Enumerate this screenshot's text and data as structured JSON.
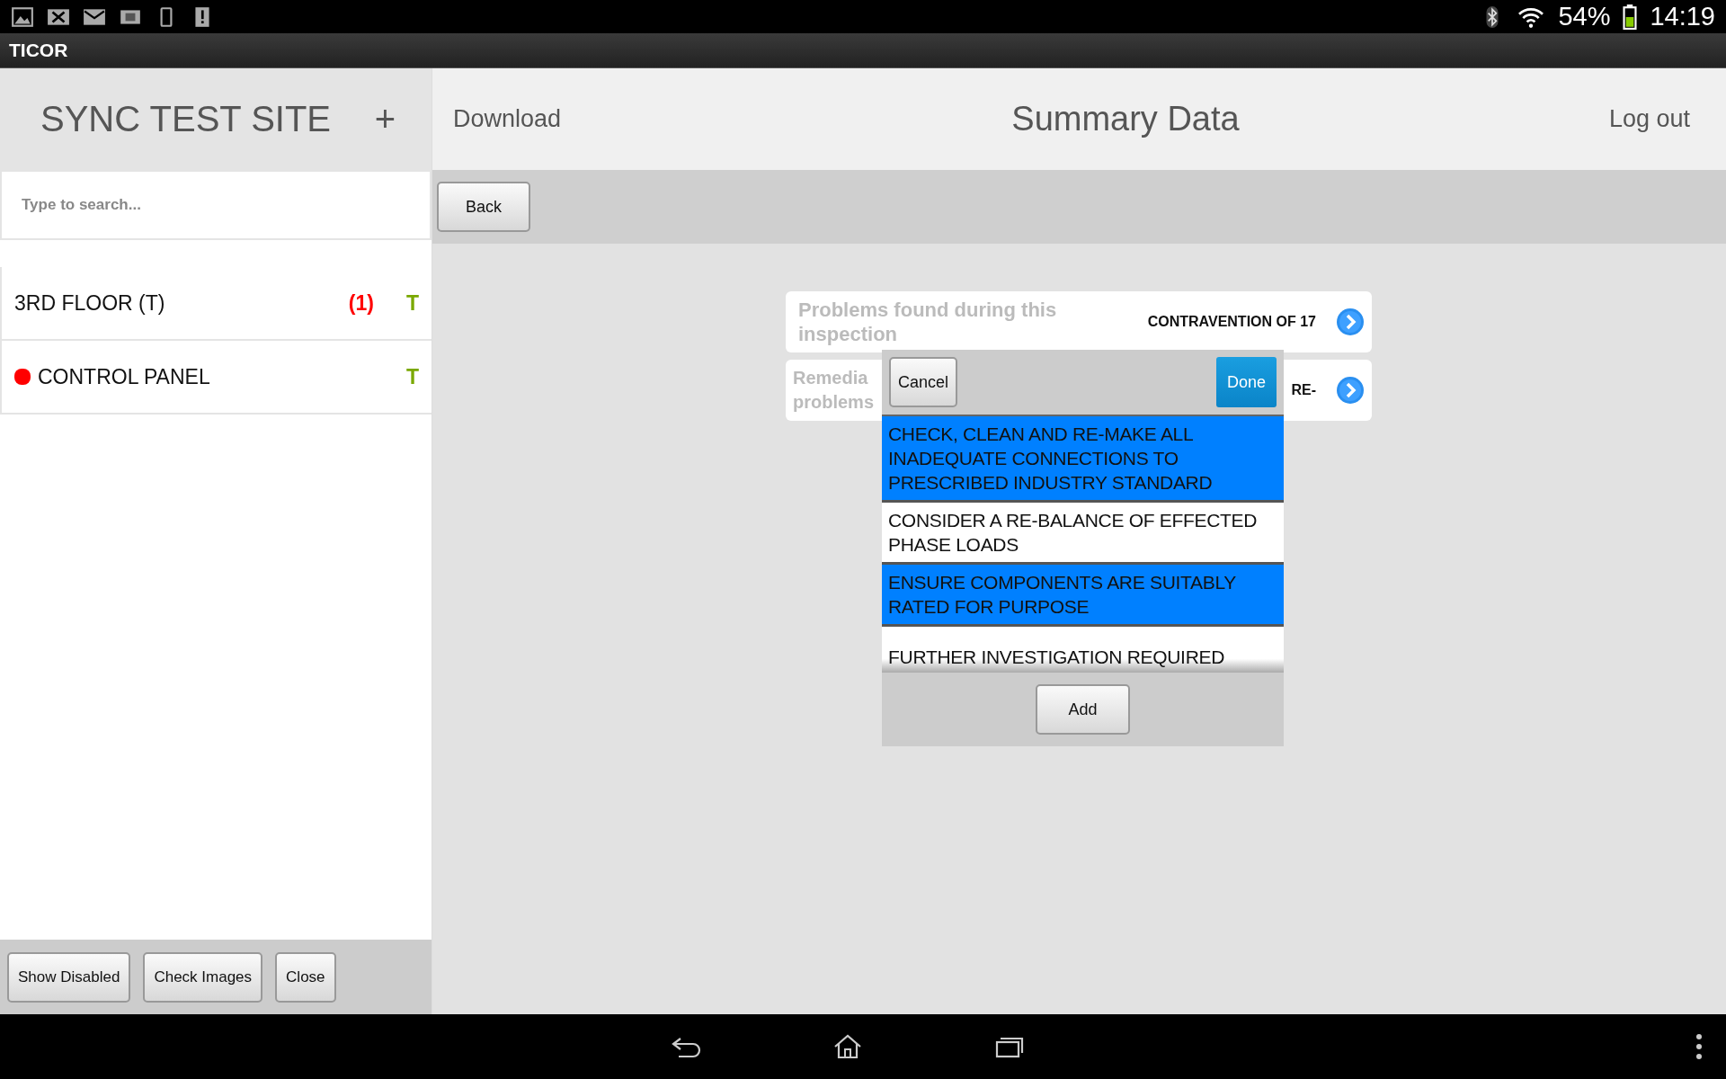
{
  "status_bar": {
    "battery_text": "54%",
    "time": "14:19"
  },
  "app_bar": {
    "title": "TICOR"
  },
  "sidebar": {
    "title": "SYNC TEST SITE",
    "add_label": "+",
    "search": {
      "placeholder": "Type to search..."
    },
    "items": [
      {
        "name": "3RD FLOOR (T)",
        "count": "(1)",
        "flag": "T",
        "alert": false
      },
      {
        "name": "CONTROL PANEL",
        "flag": "T",
        "alert": true
      }
    ],
    "buttons": [
      "Show Disabled",
      "Check Images",
      "Close"
    ]
  },
  "header": {
    "left_link": "Download",
    "title": "Summary Data",
    "right_link": "Log out"
  },
  "toolbar": {
    "back_label": "Back"
  },
  "summary_rows": [
    {
      "label": "Problems found during this inspection",
      "value": "CONTRAVENTION OF 17"
    },
    {
      "label_lines": [
        "Remedia",
        "problems"
      ],
      "value": "RE-"
    }
  ],
  "dialog": {
    "cancel_label": "Cancel",
    "done_label": "Done",
    "add_label": "Add",
    "options": [
      {
        "text": "CHECK, CLEAN AND RE-MAKE ALL INADEQUATE CONNECTIONS TO PRESCRIBED INDUSTRY STANDARD",
        "selected": true
      },
      {
        "text": "CONSIDER A RE-BALANCE OF EFFECTED PHASE LOADS",
        "selected": false
      },
      {
        "text": "ENSURE COMPONENTS ARE SUITABLY RATED FOR PURPOSE",
        "selected": true
      },
      {
        "text": "FURTHER INVESTIGATION REQUIRED",
        "selected": false
      }
    ]
  }
}
